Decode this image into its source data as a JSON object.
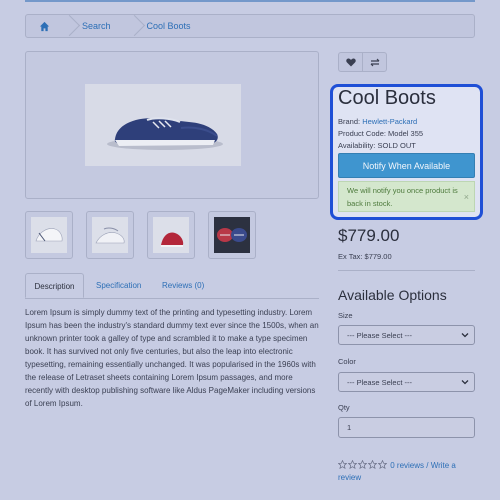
{
  "breadcrumb": {
    "items": [
      {
        "label": "",
        "icon": "home-icon"
      },
      {
        "label": "Search"
      },
      {
        "label": "Cool Boots"
      }
    ]
  },
  "product": {
    "title": "Cool Boots",
    "brand_label": "Brand:",
    "brand_value": "Hewlett-Packard",
    "code_label": "Product Code:",
    "code_value": "Model 355",
    "availability_label": "Availability:",
    "availability_value": "SOLD OUT",
    "notify_button": "Notify When Available",
    "alert_text": "We will notify you once product is back in stock.",
    "alert_close": "×",
    "price": "$779.00",
    "ex_tax": "Ex Tax: $779.00"
  },
  "actions": {
    "wishlist_icon": "heart-icon",
    "compare_icon": "compare-arrows-icon"
  },
  "tabs": [
    {
      "label": "Description",
      "active": true
    },
    {
      "label": "Specification",
      "active": false
    },
    {
      "label": "Reviews (0)",
      "active": false
    }
  ],
  "description": "Lorem Ipsum is simply dummy text of the printing and typesetting industry. Lorem Ipsum has been the industry's standard dummy text ever since the 1500s, when an unknown printer took a galley of type and scrambled it to make a type specimen book. It has survived not only five centuries, but also the leap into electronic typesetting, remaining essentially unchanged. It was popularised in the 1960s with the release of Letraset sheets containing Lorem Ipsum passages, and more recently with desktop publishing software like Aldus PageMaker including versions of Lorem Ipsum.",
  "options": {
    "title": "Available Options",
    "size_label": "Size",
    "size_value": "--- Please Select ---",
    "color_label": "Color",
    "color_value": "--- Please Select ---",
    "qty_label": "Qty",
    "qty_value": "1"
  },
  "rating": {
    "stars": 0,
    "max": 5,
    "link_text": "0 reviews / Write a review"
  },
  "colors": {
    "accent": "#2d6fb6",
    "button": "#3f95cf",
    "highlight_border": "#1f4fd6",
    "alert_bg": "#d4e7cd"
  }
}
